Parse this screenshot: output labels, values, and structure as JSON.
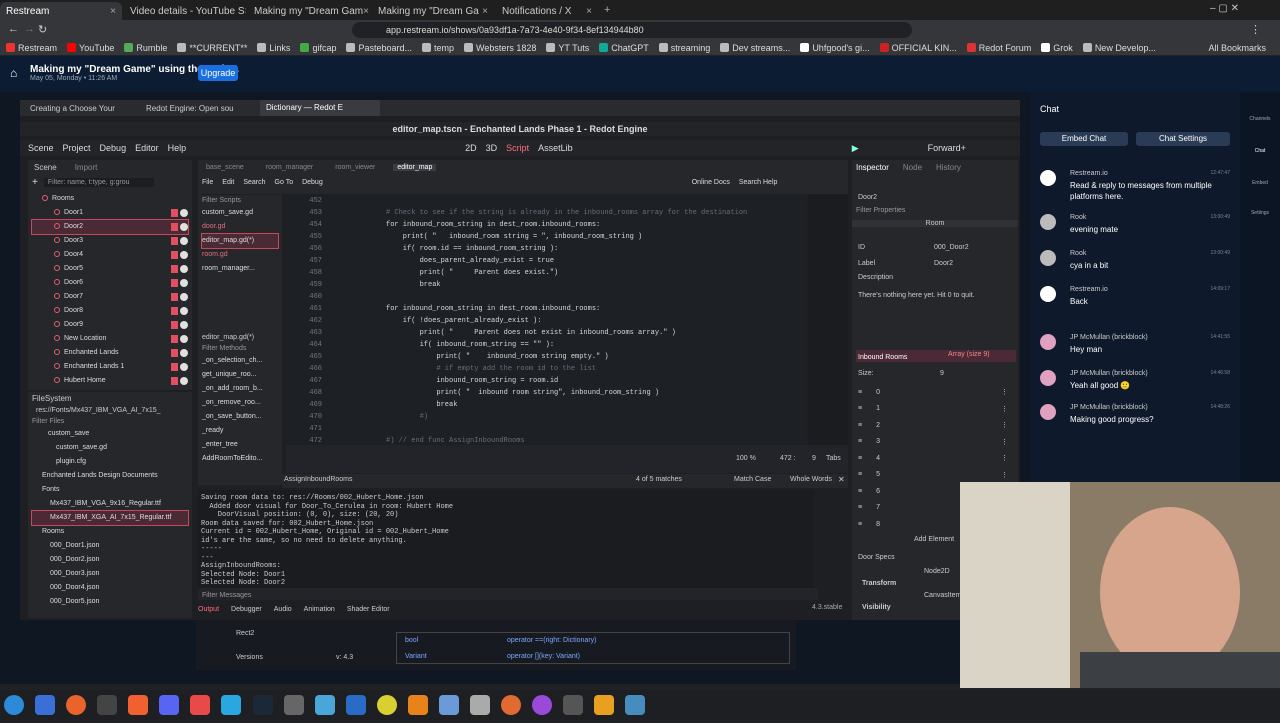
{
  "browser": {
    "tabs": [
      {
        "title": "Restream"
      },
      {
        "title": "Video details - YouTube S"
      },
      {
        "title": "Making my \"Dream Gam"
      },
      {
        "title": "Making my \"Dream Ga"
      },
      {
        "title": "Notifications / X"
      }
    ],
    "url": "app.restream.io/shows/0a93df1a-7a73-4e40-9f34-8ef134944b80",
    "bookmarks": [
      "Restream",
      "YouTube",
      "Rumble",
      "**CURRENT**",
      "Links",
      "gifcap",
      "Pasteboard...",
      "temp",
      "Websters 1828",
      "YT Tuts",
      "ChatGPT",
      "streaming",
      "Dev streams...",
      "Uhfgood's gi...",
      "OFFICIAL KIN...",
      "Redot Forum",
      "Grok",
      "New Develop..."
    ],
    "all_bookmarks": "All Bookmarks",
    "bookmark_colors": [
      "#e33",
      "#f00",
      "#5a5",
      "#bbb",
      "#bbb",
      "#4a4",
      "#bbb",
      "#bbb",
      "#bbb",
      "#bbb",
      "#1a9",
      "#bbb",
      "#bbb",
      "#fff",
      "#c22",
      "#d33",
      "#fff",
      "#bbb"
    ]
  },
  "restream": {
    "title": "Making my \"Dream Game\" using the Redo...",
    "subtitle": "May 05, Monday • 11:26 AM",
    "upgrade": "Upgrade",
    "embed_chat": "Embed Chat",
    "chat_settings": "Chat Settings",
    "chat_title": "Chat",
    "side_nav": [
      "Channels",
      "Chat",
      "Embed",
      "Settings"
    ]
  },
  "firefox": {
    "tabs": [
      "Creating a Choose Your",
      "Redot Engine: Open sou",
      "Dictionary — Redot E"
    ]
  },
  "godot": {
    "title": "editor_map.tscn - Enchanted Lands Phase 1 - Redot Engine",
    "menu": [
      "Scene",
      "Project",
      "Debug",
      "Editor",
      "Help"
    ],
    "workspaces": [
      "2D",
      "3D",
      "Script",
      "AssetLib"
    ],
    "renderer": "Forward+",
    "scene_tabs": [
      "Scene",
      "Import"
    ],
    "filter_nodes": "Filter: name, t:type, g:grou",
    "tree": [
      "Rooms",
      "Door1",
      "Door2",
      "Door3",
      "Door4",
      "Door5",
      "Door6",
      "Door7",
      "Door8",
      "Door9",
      "New Location",
      "Enchanted Lands",
      "Enchanted Lands 1",
      "Hubert Home"
    ],
    "filesystem_title": "FileSystem",
    "fs_path": "res://Fonts/Mx437_IBM_VGA_AI_7x15_",
    "filter_files": "Filter Files",
    "files": [
      "custom_save",
      "custom_save.gd",
      "plugin.cfg",
      "Enchanted Lands Design Documents",
      "Fonts",
      "Mx437_IBM_VGA_9x16_Regular.ttf",
      "Mx437_IBM_XGA_AI_7x15_Regular.ttf",
      "Rooms",
      "000_Door1.json",
      "000_Door2.json",
      "000_Door3.json",
      "000_Door4.json",
      "000_Door5.json"
    ],
    "editor_tabs": [
      "base_scene",
      "room_manager",
      "room_viewer",
      "editor_map"
    ],
    "script_menu": [
      "File",
      "Edit",
      "Search",
      "Go To",
      "Debug"
    ],
    "online_docs": "Online Docs",
    "search_help": "Search Help",
    "filter_scripts": "Filter Scripts",
    "scripts": [
      "custom_save.gd",
      "door.gd",
      "editor_map.gd(*)",
      "room.gd",
      "room_manager..."
    ],
    "current_script": "editor_map.gd(*)",
    "filter_methods": "Filter Methods",
    "methods": [
      "_on_selection_ch...",
      "get_unique_roo...",
      "_on_add_room_b...",
      "_on_remove_roo...",
      "_on_save_button...",
      "_ready",
      "_enter_tree",
      "AddRoomToEdito..."
    ],
    "current_method": "AssignInboundRooms",
    "find_status": "4 of 5 matches",
    "match_case": "Match Case",
    "whole_words": "Whole Words",
    "zoom": "100 %",
    "cursor": "472 :",
    "col": "9",
    "tabs_label": "Tabs",
    "code": [
      {
        "n": "452",
        "t": "",
        "c": "cm"
      },
      {
        "n": "453",
        "t": "# Check to see if the string is already in the inbound_rooms array for the destination",
        "c": "cm"
      },
      {
        "n": "454",
        "t": "for inbound_room_string in dest_room.inbound_rooms:",
        "c": ""
      },
      {
        "n": "455",
        "t": "    print( \"   inbound_room string = \", inbound_room_string )",
        "c": ""
      },
      {
        "n": "456",
        "t": "    if( room.id == inbound_room_string ):",
        "c": ""
      },
      {
        "n": "457",
        "t": "        does_parent_already_exist = true",
        "c": ""
      },
      {
        "n": "458",
        "t": "        print( \"     Parent does exist.\")",
        "c": ""
      },
      {
        "n": "459",
        "t": "        break",
        "c": ""
      },
      {
        "n": "460",
        "t": "",
        "c": ""
      },
      {
        "n": "461",
        "t": "for inbound_room_string in dest_room.inbound_rooms:",
        "c": ""
      },
      {
        "n": "462",
        "t": "    if( !does_parent_already_exist ):",
        "c": ""
      },
      {
        "n": "463",
        "t": "        print( \"     Parent does not exist in inbound_rooms array.\" )",
        "c": ""
      },
      {
        "n": "464",
        "t": "        if( inbound_room_string == \"\" ):",
        "c": ""
      },
      {
        "n": "465",
        "t": "            print( \"    inbound_room string empty.\" )",
        "c": ""
      },
      {
        "n": "466",
        "t": "            # if empty add the room id to the list",
        "c": "cm"
      },
      {
        "n": "467",
        "t": "            inbound_room_string = room.id",
        "c": ""
      },
      {
        "n": "468",
        "t": "            print( \"  inbound room string\", inbound_room_string )",
        "c": ""
      },
      {
        "n": "469",
        "t": "            break",
        "c": ""
      },
      {
        "n": "470",
        "t": "        #)",
        "c": "cm"
      },
      {
        "n": "471",
        "t": "",
        "c": ""
      },
      {
        "n": "472",
        "t": "#) // end func AssignInboundRooms",
        "c": "cm"
      }
    ],
    "output": [
      "Saving room data to: res://Rooms/002_Hubert_Home.json",
      "  Added door visual for Door_To_Cerulea in room: Hubert Home",
      "    DoorVisual position: (0, 0), size: (20, 20)",
      "Room data saved for: 002_Hubert_Home.json",
      "Current id = 002_Hubert_Home, Original id = 002_Hubert_Home",
      "id's are the same, so no need to delete anything.",
      "-----",
      "---",
      "AssignInboundRooms:",
      "Selected Node: Door1",
      "Selected Node: Door2"
    ],
    "filter_messages": "Filter Messages",
    "bottom_tabs": [
      "Output",
      "Debugger",
      "Audio",
      "Animation",
      "Shader Editor"
    ],
    "version": "4.3.stable",
    "inspector": {
      "tabs": [
        "Inspector",
        "Node",
        "History"
      ],
      "node": "Door2",
      "filter": "Filter Properties",
      "section": "Room",
      "id_label": "ID",
      "id_value": "000_Door2",
      "label_label": "Label",
      "label_value": "Door2",
      "desc_label": "Description",
      "desc_value": "There's nothing here yet.  Hit 0 to quit.",
      "inbound_label": "Inbound Rooms",
      "inbound_value": "Array (size 9)",
      "size_label": "Size:",
      "size_value": "9",
      "indices": [
        "0",
        "1",
        "2",
        "3",
        "4",
        "5",
        "6",
        "7",
        "8"
      ],
      "add_element": "Add Element",
      "door_specs": "Door Specs",
      "node2d": "Node2D",
      "transform": "Transform",
      "canvas_item": "CanvasItem",
      "visibility": "Visibility"
    }
  },
  "docs_bg": {
    "rect2": "Rect2",
    "versions": "Versions",
    "version_val": "v: 4.3",
    "rows": [
      {
        "type": "bool",
        "op": "operator ==(right: Dictionary)"
      },
      {
        "type": "Variant",
        "op": "operator [](key: Variant)"
      }
    ]
  },
  "chat": [
    {
      "name": "Restream.io",
      "time": "12:47:47",
      "text": "Read & reply to messages from multiple platforms here.",
      "avatar": "#fff"
    },
    {
      "name": "Rook",
      "time": "13:00:49",
      "text": "evening mate",
      "avatar": "#bbb"
    },
    {
      "name": "Rook",
      "time": "13:00:49",
      "text": "cya in a bit",
      "avatar": "#bbb"
    },
    {
      "name": "Restream.io",
      "time": "14:09:17",
      "text": "Back",
      "avatar": "#fff"
    },
    {
      "name": "JP McMullan (brickblock)",
      "time": "14:41:55",
      "text": "Hey man",
      "avatar": "#e0a0c0"
    },
    {
      "name": "JP McMullan (brickblock)",
      "time": "14:46:58",
      "text": "Yeah all good 🙂",
      "avatar": "#e0a0c0"
    },
    {
      "name": "JP McMullan (brickblock)",
      "time": "14:48:26",
      "text": "Making good progress?",
      "avatar": "#e0a0c0"
    }
  ]
}
